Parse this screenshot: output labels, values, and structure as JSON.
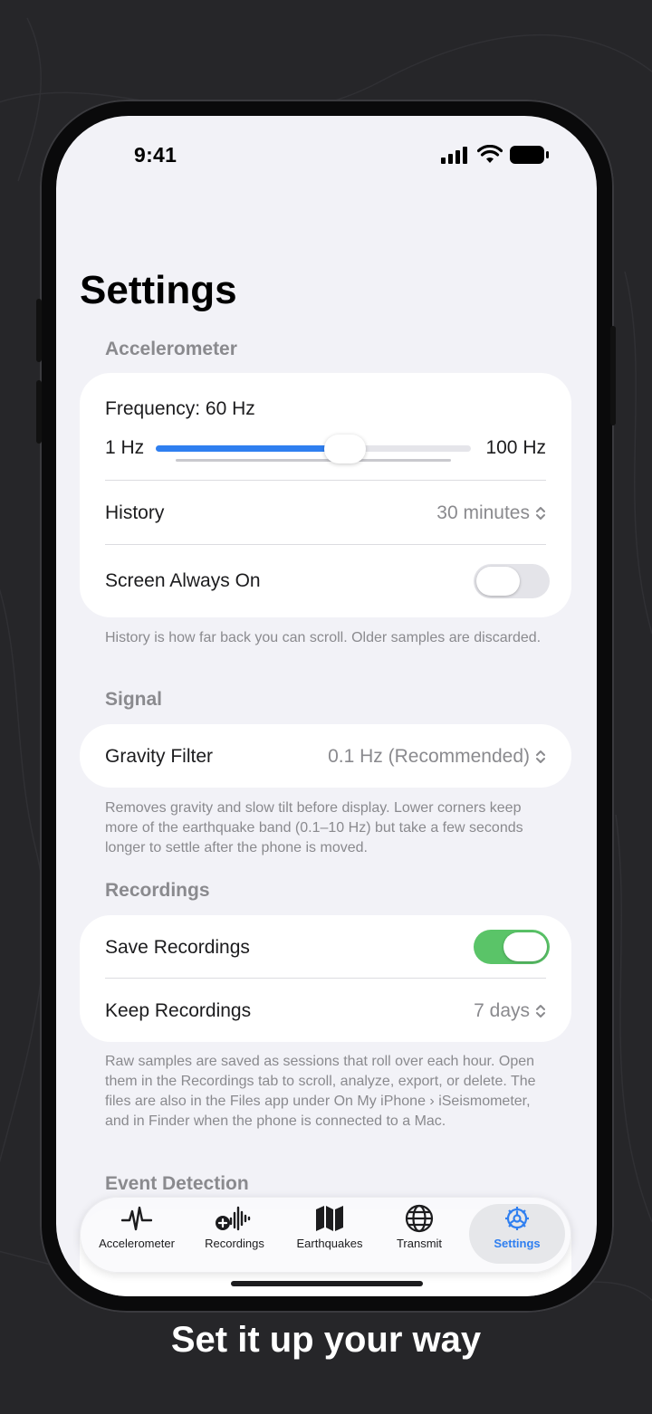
{
  "status_bar": {
    "time": "9:41"
  },
  "page": {
    "title": "Settings"
  },
  "accelerometer": {
    "header": "Accelerometer",
    "frequency_label": "Frequency: 60 Hz",
    "slider_min_label": "1 Hz",
    "slider_max_label": "100 Hz",
    "slider_fraction": 0.6,
    "history_label": "History",
    "history_value": "30 minutes",
    "screen_on_label": "Screen Always On",
    "screen_on_enabled": false,
    "footnote": "History is how far back you can scroll. Older samples are discarded."
  },
  "signal": {
    "header": "Signal",
    "gravity_label": "Gravity Filter",
    "gravity_value": "0.1 Hz (Recommended)",
    "footnote": "Removes gravity and slow tilt before display. Lower corners keep more of the earthquake band (0.1–10 Hz) but take a few seconds longer to settle after the phone is moved."
  },
  "recordings": {
    "header": "Recordings",
    "save_label": "Save Recordings",
    "save_enabled": true,
    "keep_label": "Keep Recordings",
    "keep_value": "7 days",
    "footnote": "Raw samples are saved as sessions that roll over each hour. Open them in the Recordings tab to scroll, analyze, export, or delete. The files are also in the Files app under On My iPhone › iSeismometer, and in Finder when the phone is connected to a Mac."
  },
  "event_detection": {
    "header": "Event Detection"
  },
  "tabbar": {
    "tabs": [
      {
        "label": "Accelerometer",
        "icon": "waveform-pulse-icon"
      },
      {
        "label": "Recordings",
        "icon": "recording-waveform-icon"
      },
      {
        "label": "Earthquakes",
        "icon": "map-icon"
      },
      {
        "label": "Transmit",
        "icon": "globe-icon"
      },
      {
        "label": "Settings",
        "icon": "gear-icon"
      }
    ],
    "active_index": 4
  },
  "caption": "Set it up your way",
  "colors": {
    "accent": "#2f7ff0",
    "toggle_on": "#5ac468",
    "toggle_off": "#e4e4e9",
    "background": "#262629"
  }
}
